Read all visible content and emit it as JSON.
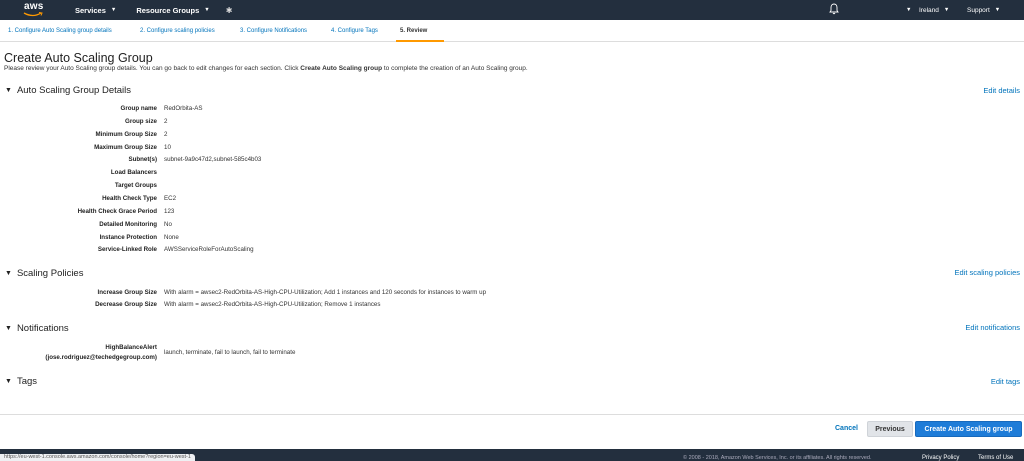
{
  "nav": {
    "logo": "aws",
    "services": "Services",
    "resource_groups": "Resource Groups",
    "region": "Ireland",
    "support": "Support"
  },
  "steps": [
    {
      "label": "1. Configure Auto Scaling group details"
    },
    {
      "label": "2. Configure scaling policies"
    },
    {
      "label": "3. Configure Notifications"
    },
    {
      "label": "4. Configure Tags"
    },
    {
      "label": "5. Review"
    }
  ],
  "page": {
    "title": "Create Auto Scaling Group",
    "desc_before": "Please review your Auto Scaling group details. You can go back to edit changes for each section. Click ",
    "desc_bold": "Create Auto Scaling group",
    "desc_after": " to complete the creation of an Auto Scaling group."
  },
  "details": {
    "title": "Auto Scaling Group Details",
    "edit": "Edit details",
    "rows": [
      {
        "label": "Group name",
        "value": "RedOrbita-AS"
      },
      {
        "label": "Group size",
        "value": "2"
      },
      {
        "label": "Minimum Group Size",
        "value": "2"
      },
      {
        "label": "Maximum Group Size",
        "value": "10"
      },
      {
        "label": "Subnet(s)",
        "value": "subnet-9a9c47d2,subnet-585c4b03"
      },
      {
        "label": "Load Balancers",
        "value": ""
      },
      {
        "label": "Target Groups",
        "value": ""
      },
      {
        "label": "Health Check Type",
        "value": "EC2"
      },
      {
        "label": "Health Check Grace Period",
        "value": "123"
      },
      {
        "label": "Detailed Monitoring",
        "value": "No"
      },
      {
        "label": "Instance Protection",
        "value": "None"
      },
      {
        "label": "Service-Linked Role",
        "value": "AWSServiceRoleForAutoScaling"
      }
    ]
  },
  "policies": {
    "title": "Scaling Policies",
    "edit": "Edit scaling policies",
    "rows": [
      {
        "label": "Increase Group Size",
        "value": "With alarm = awsec2-RedOrbita-AS-High-CPU-Utilization; Add 1 instances and 120 seconds for instances to warm up"
      },
      {
        "label": "Decrease Group Size",
        "value": "With alarm = awsec2-RedOrbita-AS-High-CPU-Utilization; Remove 1 instances"
      }
    ]
  },
  "notifications": {
    "title": "Notifications",
    "edit": "Edit notifications",
    "label_line1": "HighBalanceAlert",
    "label_line2": "(jose.rodriguez@techedgegroup.com)",
    "value": "launch, terminate, fail to launch, fail to terminate"
  },
  "tags": {
    "title": "Tags",
    "edit": "Edit tags"
  },
  "actions": {
    "cancel": "Cancel",
    "previous": "Previous",
    "create": "Create Auto Scaling group"
  },
  "footer": {
    "status_url": "https://eu-west-1.console.aws.amazon.com/console/home?region=eu-west-1",
    "copyright": "© 2008 - 2018, Amazon Web Services, Inc. or its affiliates. All rights reserved.",
    "privacy": "Privacy Policy",
    "terms": "Terms of Use"
  },
  "colors": {
    "nav_bg": "#232f3e",
    "link": "#0073bb",
    "primary_button": "#1e7cd8",
    "active_step_underline": "#ff9900"
  }
}
